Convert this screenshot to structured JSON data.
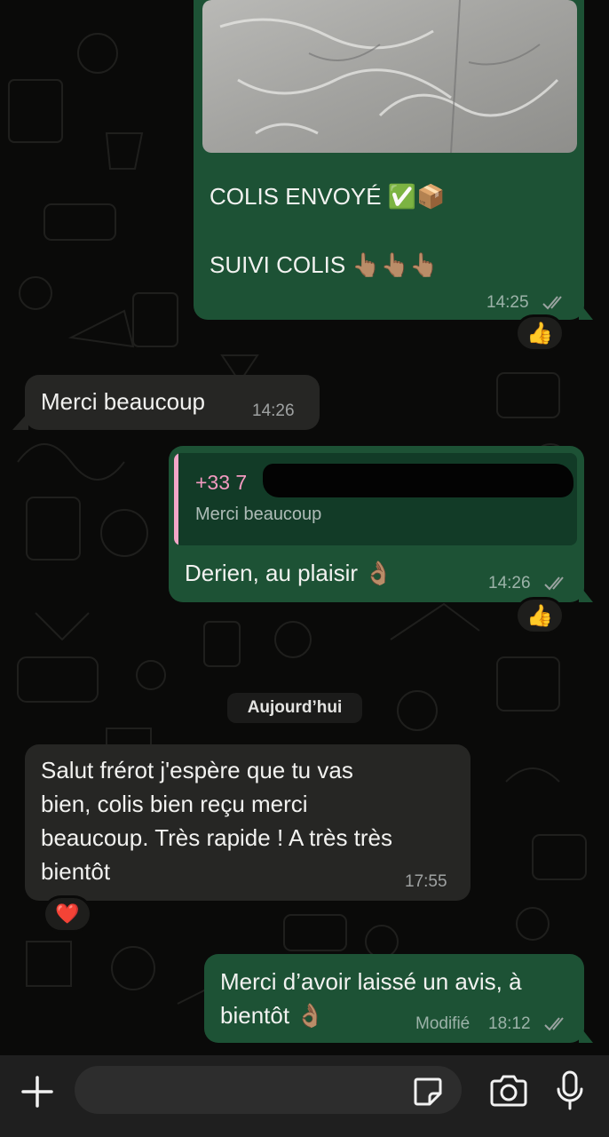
{
  "colors": {
    "outgoing_bubble": "#1d5235",
    "incoming_bubble": "#262624",
    "background": "#0a0a09",
    "quote_accent": "#f49ac1",
    "read_ticks": "#9aa3a0"
  },
  "messages": {
    "m1": {
      "direction": "outgoing",
      "has_image": true,
      "line1": "COLIS ENVOYÉ ✅📦",
      "line2": "SUIVI COLIS 👆🏽👆🏽👆🏽",
      "time": "14:25",
      "status": "read",
      "reaction": "👍"
    },
    "m2": {
      "direction": "incoming",
      "text": "Merci beaucoup",
      "time": "14:26"
    },
    "m3": {
      "direction": "outgoing",
      "quote": {
        "name": "+33 7",
        "text": "Merci beaucoup"
      },
      "text": "Derien, au plaisir 👌🏽",
      "time": "14:26",
      "status": "read",
      "reaction": "👍"
    },
    "date_separator": "Aujourd’hui",
    "m4": {
      "direction": "incoming",
      "lines": [
        "Salut frérot j'espère que tu vas",
        "bien, colis bien reçu merci",
        "beaucoup. Très rapide ! A très très",
        "bientôt"
      ],
      "time": "17:55",
      "reaction": "❤️"
    },
    "m5": {
      "direction": "outgoing",
      "lines": [
        "Merci d’avoir laissé un avis, à",
        "bientôt 👌🏽"
      ],
      "edited_label": "Modifié",
      "time": "18:12",
      "status": "read"
    }
  },
  "composer": {
    "icons": [
      "plus-icon",
      "sticker-icon",
      "camera-icon",
      "microphone-icon"
    ]
  }
}
